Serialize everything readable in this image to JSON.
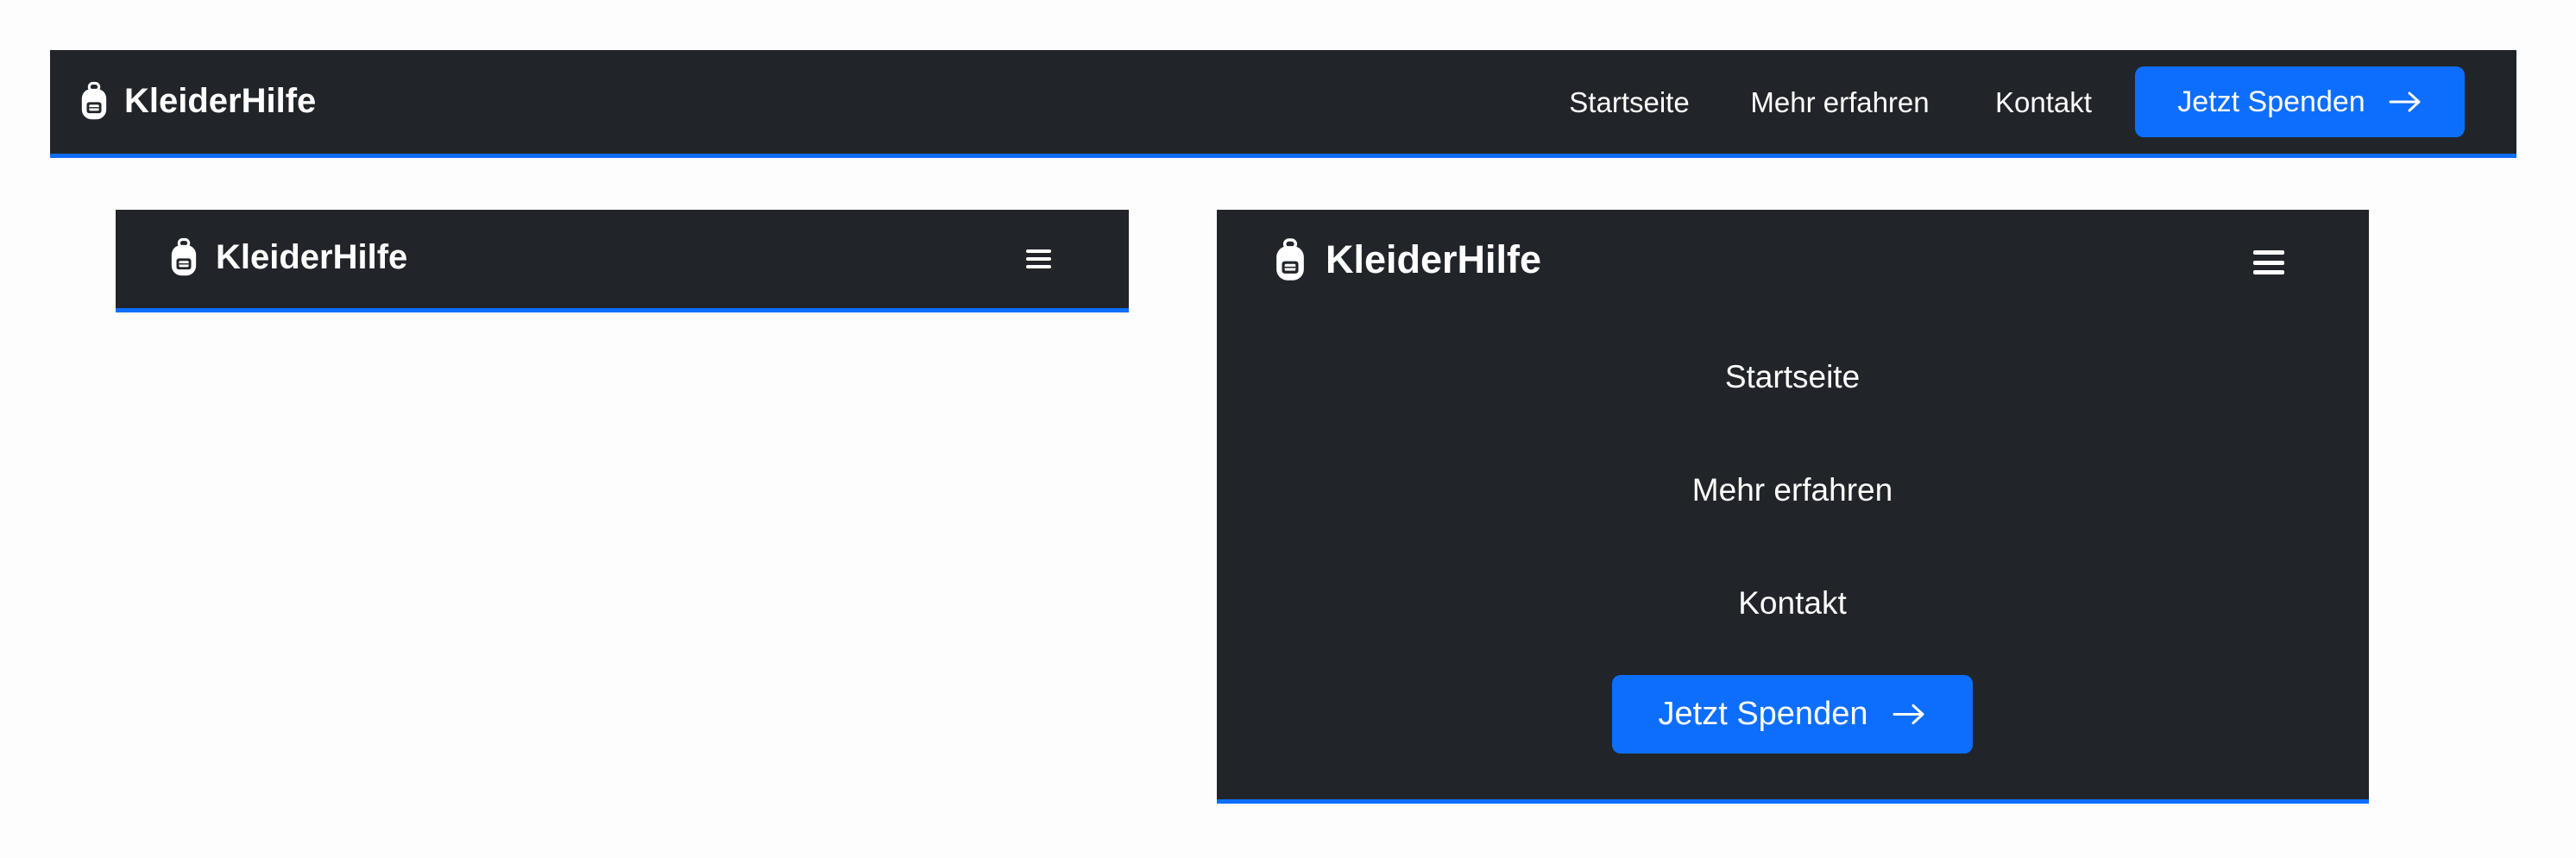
{
  "brand": {
    "name": "KleiderHilfe",
    "icon": "backpack-icon"
  },
  "nav_links": [
    "Startseite",
    "Mehr erfahren",
    "Kontakt"
  ],
  "donate_button": {
    "label": "Jetzt Spenden",
    "icon": "arrow-right-icon"
  },
  "menu_toggle": {
    "icon": "hamburger-icon"
  },
  "colors": {
    "navbar_bg": "#212529",
    "accent": "#0d6efd",
    "text": "#ffffff",
    "page_bg": "#fdfdfd"
  }
}
